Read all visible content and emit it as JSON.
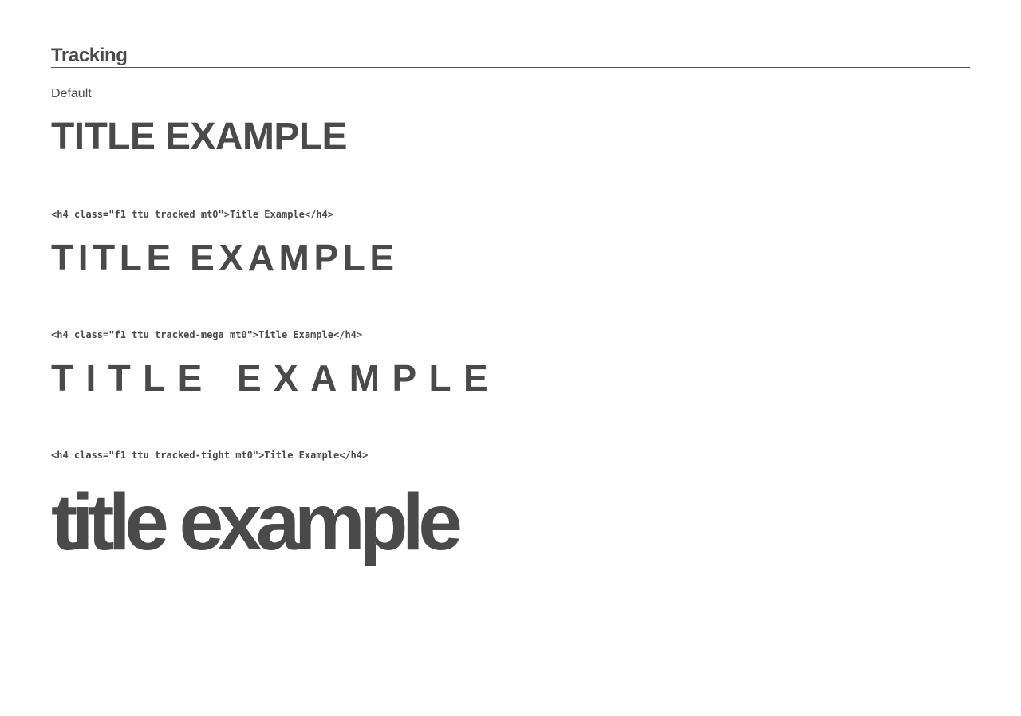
{
  "section": {
    "title": "Tracking"
  },
  "examples": [
    {
      "label": "Default",
      "text": "TITLE EXAMPLE"
    },
    {
      "code": "<h4 class=\"f1 ttu tracked mt0\">Title Example</h4>",
      "text": "TITLE EXAMPLE"
    },
    {
      "code": "<h4 class=\"f1 ttu tracked-mega mt0\">Title Example</h4>",
      "text": "TITLE EXAMPLE"
    },
    {
      "code": "<h4 class=\"f1 ttu tracked-tight mt0\">Title Example</h4>",
      "text": "title example"
    }
  ],
  "colors": {
    "text": "#4a4a4a",
    "rule": "#555555",
    "background": "#ffffff"
  }
}
